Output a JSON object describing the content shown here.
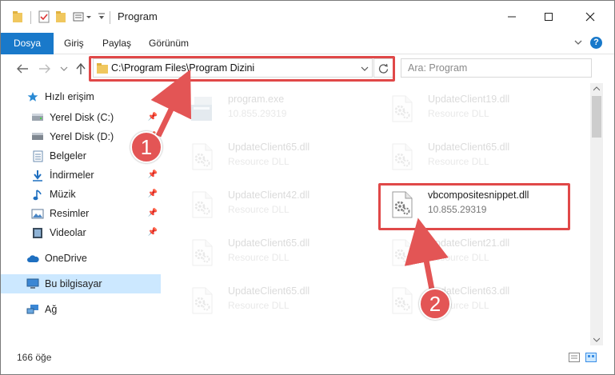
{
  "window": {
    "title": "Program",
    "controls": {
      "minimize": "minimize",
      "maximize": "maximize",
      "close": "close"
    }
  },
  "ribbon": {
    "tabs": [
      "Dosya",
      "Giriş",
      "Paylaş",
      "Görünüm"
    ]
  },
  "address": {
    "path": "C:\\Program Files\\Program Dizini",
    "search_placeholder": "Ara: Program"
  },
  "nav": {
    "items": [
      {
        "label": "Hızlı erişim",
        "icon": "star-icon"
      },
      {
        "label": "Yerel Disk (C:)",
        "icon": "drive-icon",
        "pinned": true
      },
      {
        "label": "Yerel Disk (D:)",
        "icon": "drive-icon",
        "pinned": true
      },
      {
        "label": "Belgeler",
        "icon": "documents-icon",
        "pinned": true
      },
      {
        "label": "İndirmeler",
        "icon": "download-icon",
        "pinned": true
      },
      {
        "label": "Müzik",
        "icon": "music-icon",
        "pinned": true
      },
      {
        "label": "Resimler",
        "icon": "pictures-icon",
        "pinned": true
      },
      {
        "label": "Videolar",
        "icon": "video-icon",
        "pinned": true
      },
      {
        "label": "OneDrive",
        "icon": "cloud-icon"
      },
      {
        "label": "Bu bilgisayar",
        "icon": "computer-icon",
        "selected": true
      },
      {
        "label": "Ağ",
        "icon": "network-icon"
      }
    ]
  },
  "files": [
    {
      "name": "program.exe",
      "sub": "10.855.29319",
      "faded": true,
      "type": "exe"
    },
    {
      "name": "UpdateClient19.dll",
      "sub": "Resource DLL",
      "faded": true,
      "type": "dll"
    },
    {
      "name": "UpdateClient65.dll",
      "sub": "Resource DLL",
      "faded": true,
      "type": "dll"
    },
    {
      "name": "UpdateClient65.dll",
      "sub": "Resource DLL",
      "faded": true,
      "type": "dll"
    },
    {
      "name": "UpdateClient42.dll",
      "sub": "Resource DLL",
      "faded": true,
      "type": "dll"
    },
    {
      "name": "vbcompositesnippet.dll",
      "sub": "10.855.29319",
      "faded": false,
      "type": "dll"
    },
    {
      "name": "UpdateClient65.dll",
      "sub": "Resource DLL",
      "faded": true,
      "type": "dll"
    },
    {
      "name": "UpdateClient21.dll",
      "sub": "Resource DLL",
      "faded": true,
      "type": "dll"
    },
    {
      "name": "UpdateClient65.dll",
      "sub": "Resource DLL",
      "faded": true,
      "type": "dll"
    },
    {
      "name": "UpdateClient63.dll",
      "sub": "Resource DLL",
      "faded": true,
      "type": "dll"
    }
  ],
  "status": {
    "count": "166 öğe"
  },
  "callouts": {
    "one": "1",
    "two": "2"
  },
  "colors": {
    "accent": "#1979ca",
    "highlight": "#e04848",
    "selected_nav": "#cce8ff"
  }
}
